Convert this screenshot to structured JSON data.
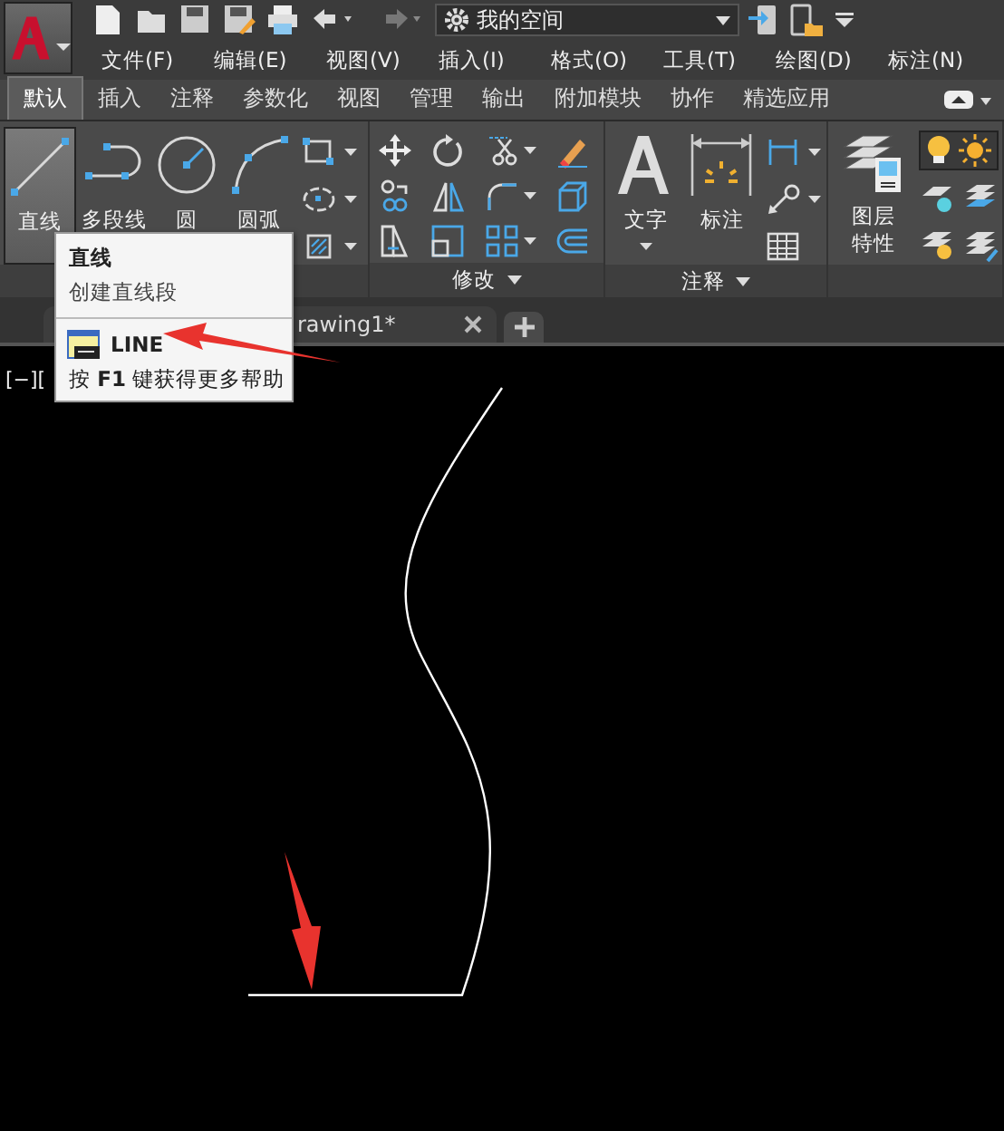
{
  "quick_access": {
    "workspace": "我的空间"
  },
  "menu": [
    "文件(F)",
    "编辑(E)",
    "视图(V)",
    "插入(I)",
    "格式(O)",
    "工具(T)",
    "绘图(D)",
    "标注(N)"
  ],
  "ribbon_tabs": [
    {
      "label": "默认",
      "selected": true
    },
    {
      "label": "插入",
      "selected": false
    },
    {
      "label": "注释",
      "selected": false
    },
    {
      "label": "参数化",
      "selected": false
    },
    {
      "label": "视图",
      "selected": false
    },
    {
      "label": "管理",
      "selected": false
    },
    {
      "label": "输出",
      "selected": false
    },
    {
      "label": "附加模块",
      "selected": false
    },
    {
      "label": "协作",
      "selected": false
    },
    {
      "label": "精选应用",
      "selected": false
    }
  ],
  "draw_tools": [
    {
      "kind": "line",
      "label": "直线",
      "selected": true
    },
    {
      "kind": "polyline",
      "label": "多段线",
      "selected": false
    },
    {
      "kind": "circle",
      "label": "圆",
      "selected": false
    },
    {
      "kind": "arc",
      "label": "圆弧",
      "selected": false
    }
  ],
  "modify_panel": {
    "title": "修改"
  },
  "annotation_panel": {
    "title": "注释",
    "tools": [
      "文字",
      "标注"
    ]
  },
  "layers_panel": {
    "tool": "图层特性"
  },
  "file_tabs": [
    {
      "label": "rawing1*"
    }
  ],
  "viewport_label": "[−][",
  "tooltip": {
    "title": "直线",
    "description": "创建直线段",
    "command": "LINE",
    "help": "按 **F1** 键获得更多帮助"
  }
}
